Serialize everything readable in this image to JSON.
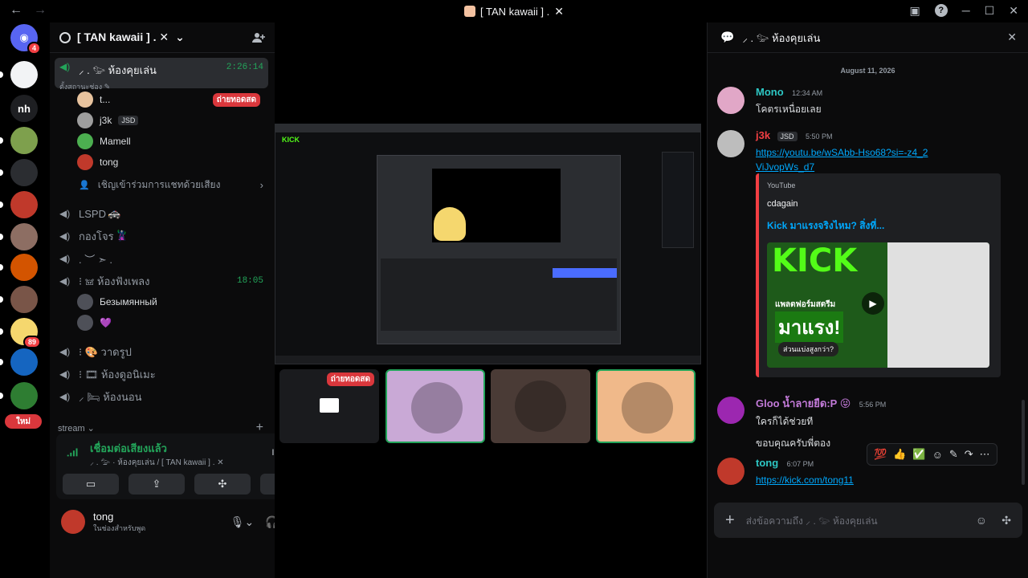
{
  "window": {
    "title": "[ TAN kawaii ] .",
    "back_glyph": "←",
    "forward_glyph": "→",
    "inbox_glyph": "▣",
    "help_glyph": "?",
    "min_glyph": "─",
    "max_glyph": "☐",
    "close_glyph": "✕"
  },
  "servers": [
    {
      "label": "",
      "badge": "4",
      "color": "#5865f2",
      "icon": "discord-icon"
    },
    {
      "label": "",
      "badge": "",
      "color": "#f2f3f5",
      "icon": "avatar"
    },
    {
      "label": "nh",
      "badge": "",
      "color": "#1e1f22",
      "icon": "text"
    },
    {
      "label": "",
      "badge": "",
      "color": "#7ea04d",
      "icon": "avatar"
    },
    {
      "label": "",
      "badge": "",
      "color": "#2b2d31",
      "icon": "avatar"
    },
    {
      "label": "",
      "badge": "",
      "color": "#c0392b",
      "icon": "avatar"
    },
    {
      "label": "",
      "badge": "",
      "color": "#8d6e63",
      "icon": "avatar"
    },
    {
      "label": "",
      "badge": "",
      "color": "#d35400",
      "icon": "avatar"
    },
    {
      "label": "",
      "badge": "",
      "color": "#795548",
      "icon": "avatar"
    },
    {
      "label": "",
      "badge": "89",
      "color": "#f5d76e",
      "icon": "avatar"
    },
    {
      "label": "",
      "badge": "",
      "color": "#1565c0",
      "icon": "avatar"
    },
    {
      "label": "",
      "badge": "",
      "color": "#2e7d32",
      "icon": "avatar"
    },
    {
      "label": "ใหม่",
      "badge": "",
      "color": "#da373c",
      "icon": "new-pill"
    }
  ],
  "guild": {
    "name": "[ TAN kawaii ] . ✕",
    "chevron": "⌄"
  },
  "channels": {
    "active": {
      "name": "⸝ .  𓅰  ห้องคุยเล่น",
      "time": "2:26:14",
      "status": "ตั้งสถานะช่อง ✎"
    },
    "voice_users": [
      {
        "name": "t...",
        "live": "ถ่ายทอดสด",
        "tag": "",
        "color": "#e8c39e"
      },
      {
        "name": "j3k",
        "live": "",
        "tag": "JSD",
        "color": "#9e9e9e"
      },
      {
        "name": "Mamell",
        "live": "",
        "tag": "",
        "color": "#4caf50"
      },
      {
        "name": "tong",
        "live": "",
        "tag": "",
        "color": "#c0392b"
      }
    ],
    "invite": "เชิญเข้าร่วมการแชทด้วยเสียง",
    "list": [
      {
        "name": "LSPD",
        "suffix": "🚓",
        "time": ""
      },
      {
        "name": "กองโจร",
        "suffix": "🦹",
        "time": ""
      },
      {
        "name": ".  ︶   ➣   .",
        "suffix": "",
        "time": ""
      },
      {
        "name": "⁝  𖠌  ห้องฟังเพลง",
        "suffix": "",
        "time": "18:05"
      }
    ],
    "music_users": [
      {
        "name": "Безымянный"
      },
      {
        "name": "💜"
      }
    ],
    "list2": [
      {
        "name": "⁝  🎨  วาดรูป"
      },
      {
        "name": "⁝  🎞  ห้องดูอนิเมะ"
      },
      {
        "name": "⸝  🛏  ห้องนอน"
      }
    ],
    "category": "stream ⌄",
    "add_glyph": "+"
  },
  "voice_panel": {
    "title": "เชื่อมต่อเสียงแล้ว",
    "subtitle": "⸝ .  𓅰 · ห้องคุยเล่น / [ TAN kawaii ] . ✕",
    "buttons": [
      "▭",
      "⇪",
      "✣",
      "🚀"
    ]
  },
  "user": {
    "name": "tong",
    "status": "ในช่องสำหรับพูด"
  },
  "stage": {
    "live_badge": "ถ่ายทอดสด",
    "tiles": [
      {
        "name": "screenshare-tile",
        "speaking": false
      },
      {
        "name": "girl-avatar-tile",
        "speaking": true,
        "color": "#c9a9d6"
      },
      {
        "name": "red-hair-avatar-tile",
        "speaking": false,
        "color": "#4a3b36"
      },
      {
        "name": "anime-avatar-tile",
        "speaking": true,
        "color": "#f0b98a"
      }
    ]
  },
  "chat": {
    "title": "⸝ .  𓅰  ห้องคุยเล่น",
    "date_divider": "August 11, 2026",
    "messages": [
      {
        "author": "Mono",
        "color": "#2dc7c4",
        "time": "12:34 AM",
        "text": "โคตรเหนื่อยเลย",
        "avatar": "#e1a7c7"
      },
      {
        "author": "j3k",
        "tag": "JSD",
        "color": "#f23f43",
        "time": "5:50 PM",
        "link": "https://youtu.be/wSAbb-Hso68?si=-z4_2ViJvopWs_d7",
        "avatar": "#bdbdbd"
      },
      {
        "author": "Gloo น้ำลายยืด:P 😝",
        "color": "#c27ad8",
        "time": "5:56 PM",
        "lines": [
          "ใครก็ได้ช่วยที",
          "ขอบคุณครับพี่ตอง"
        ],
        "avatar": "#9c27b0"
      },
      {
        "author": "tong",
        "color": "#2dc7c4",
        "time": "6:07 PM",
        "link": "https://kick.com/tong11",
        "avatar": "#c0392b"
      }
    ],
    "embed": {
      "provider": "YouTube",
      "author": "cdagain",
      "title": "Kick มาแรงจริงไหม? สิ่งที่...",
      "thumb_line1": "แพลตฟอร์มสตรีม",
      "thumb_line2": "มาแรง!",
      "thumb_line3": "ส่วนแบ่งสูงกว่า?",
      "thumb_brand": "KICK"
    },
    "reactions": [
      "💯",
      "👍",
      "✅"
    ],
    "composer_placeholder": "ส่งข้อความถึง ⸝ .  𓅰  ห้องคุยเล่น"
  },
  "colors": {
    "accent_green": "#23a55a",
    "live_red": "#da373c",
    "link_blue": "#00a8fc"
  }
}
